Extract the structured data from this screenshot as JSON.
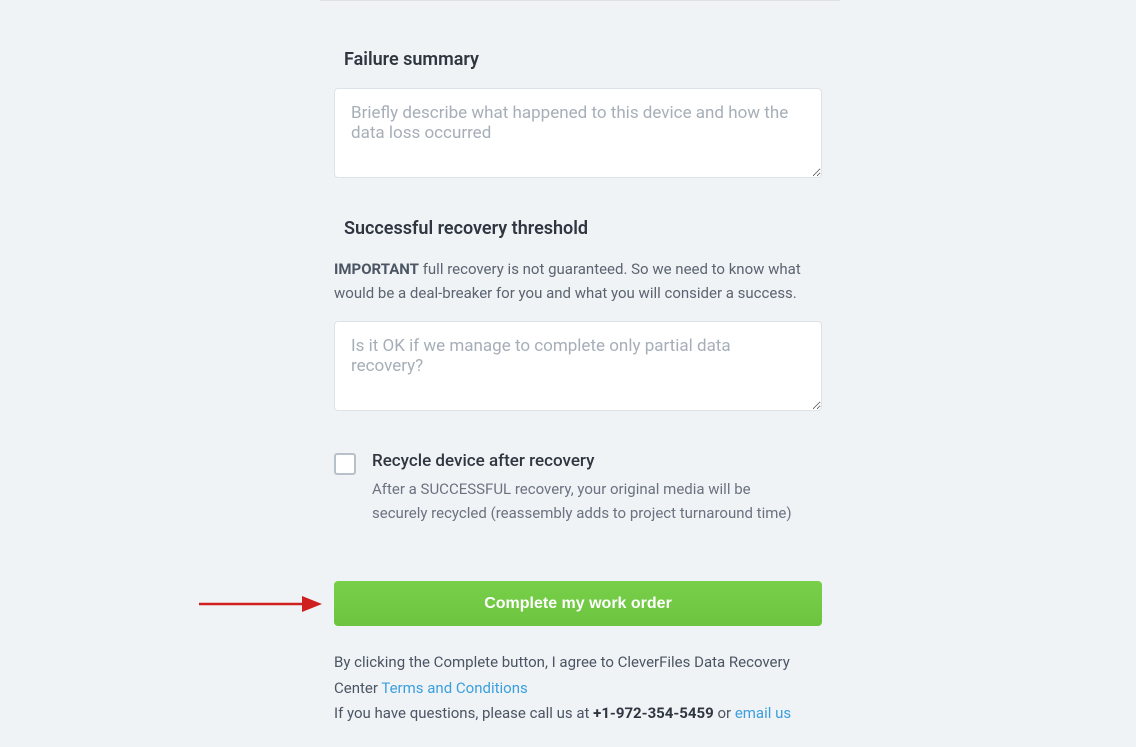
{
  "failure": {
    "label": "Failure summary",
    "placeholder": "Briefly describe what happened to this device and how the data loss occurred"
  },
  "threshold": {
    "label": "Successful recovery threshold",
    "important_strong": "IMPORTANT",
    "important_text": " full recovery is not guaranteed. So we need to know what would be a deal-breaker for you and what you will consider a success.",
    "placeholder": "Is it OK if we manage to complete only partial data recovery?"
  },
  "recycle": {
    "label": "Recycle device after recovery",
    "desc": "After a SUCCESSFUL recovery, your original media will be securely recycled (reassembly adds to project turnaround time)"
  },
  "submit": {
    "button": "Complete my work order"
  },
  "legal": {
    "line1_prefix": "By clicking the Complete button, I agree to CleverFiles Data Recovery Center ",
    "terms_link": "Terms and Conditions",
    "line2_prefix": "If you have questions, please call us at ",
    "phone": "+1-972-354-5459",
    "line2_or": " or ",
    "email_link": "email us"
  }
}
